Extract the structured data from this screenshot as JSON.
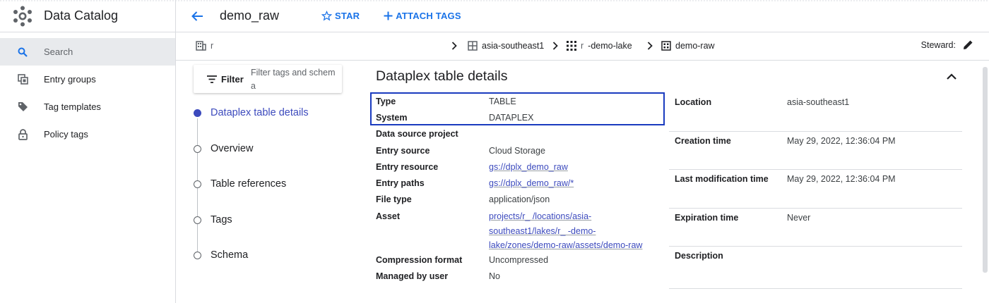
{
  "app": {
    "title": "Data Catalog"
  },
  "nav": {
    "items": [
      {
        "label": "Search",
        "icon": "search-icon"
      },
      {
        "label": "Entry groups",
        "icon": "entry-groups-icon"
      },
      {
        "label": "Tag templates",
        "icon": "tag-icon"
      },
      {
        "label": "Policy tags",
        "icon": "lock-icon"
      }
    ]
  },
  "toolbar": {
    "title": "demo_raw",
    "star_label": "STAR",
    "attach_tags_label": "ATTACH TAGS"
  },
  "breadcrumb": {
    "project": "r",
    "location": "asia-southeast1",
    "lake": "-demo-lake",
    "lake_prefix": "r",
    "zone": "demo-raw",
    "steward_label": "Steward:"
  },
  "filter": {
    "label": "Filter",
    "placeholder": "Filter tags and schema"
  },
  "sections": [
    {
      "label": "Dataplex table details",
      "active": true
    },
    {
      "label": "Overview",
      "active": false
    },
    {
      "label": "Table references",
      "active": false
    },
    {
      "label": "Tags",
      "active": false
    },
    {
      "label": "Schema",
      "active": false
    }
  ],
  "details": {
    "title": "Dataplex table details",
    "left": [
      {
        "key": "Type",
        "value": "TABLE"
      },
      {
        "key": "System",
        "value": "DATAPLEX"
      },
      {
        "key": "Data source project",
        "value": ""
      },
      {
        "key": "Entry source",
        "value": "Cloud Storage"
      },
      {
        "key": "Entry resource",
        "value": "gs://dplx_demo_raw"
      },
      {
        "key": "Entry paths",
        "value": "gs://dplx_demo_raw/*"
      },
      {
        "key": "File type",
        "value": "application/json"
      },
      {
        "key": "Asset",
        "value": "projects/r_ /locations/asia-southeast1/lakes/r_ -demo-lake/zones/demo-raw/assets/demo-raw"
      },
      {
        "key": "Compression format",
        "value": "Uncompressed"
      },
      {
        "key": "Managed by user",
        "value": "No"
      }
    ],
    "right": [
      {
        "key": "Location",
        "value": "asia-southeast1"
      },
      {
        "key": "Creation time",
        "value": "May 29, 2022, 12:36:04 PM"
      },
      {
        "key": "Last modification time",
        "value": "May 29, 2022, 12:36:04 PM"
      },
      {
        "key": "Expiration time",
        "value": "Never"
      },
      {
        "key": "Description",
        "value": ""
      }
    ]
  },
  "colors": {
    "accent": "#1a73e8",
    "active_section": "#3c4abd",
    "highlight_box": "#1a3bbf"
  }
}
